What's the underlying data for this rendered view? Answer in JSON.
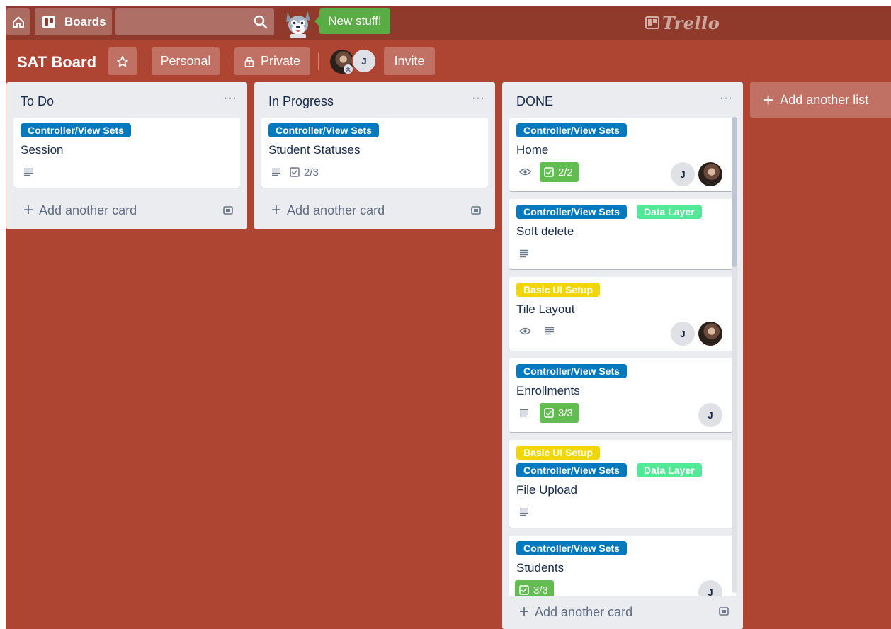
{
  "header": {
    "boards_label": "Boards",
    "search_placeholder": "",
    "new_stuff_label": "New stuff!",
    "logo_text": "Trello"
  },
  "board": {
    "title": "SAT Board",
    "visibility_team": "Personal",
    "visibility": "Private",
    "member_initial": "J",
    "invite_label": "Invite",
    "add_list_label": "Add another list"
  },
  "lists": [
    {
      "title": "To Do",
      "add_card_label": "Add another card",
      "cards": [
        {
          "labels": [
            "Controller/View Sets"
          ],
          "title": "Session"
        }
      ]
    },
    {
      "title": "In Progress",
      "add_card_label": "Add another card",
      "cards": [
        {
          "labels": [
            "Controller/View Sets"
          ],
          "title": "Student Statuses",
          "checklist": "2/3"
        }
      ]
    },
    {
      "title": "DONE",
      "add_card_label": "Add another card",
      "cards": [
        {
          "labels": [
            "Controller/View Sets"
          ],
          "title": "Home",
          "checklist": "2/2",
          "member": "J"
        },
        {
          "labels": [
            "Controller/View Sets",
            "Data Layer"
          ],
          "title": "Soft delete"
        },
        {
          "labels": [
            "Basic UI Setup"
          ],
          "title": "Tile Layout",
          "member": "J"
        },
        {
          "labels": [
            "Controller/View Sets"
          ],
          "title": "Enrollments",
          "checklist": "3/3",
          "member": "J"
        },
        {
          "labels": [
            "Basic UI Setup",
            "Controller/View Sets",
            "Data Layer"
          ],
          "title": "File Upload"
        },
        {
          "labels": [
            "Controller/View Sets"
          ],
          "title": "Students",
          "checklist": "3/3",
          "member": "J"
        }
      ]
    }
  ],
  "colors": {
    "board_bg": "#ae4532",
    "header_bg": "#8f3a2b",
    "label_blue": "#0079bf",
    "label_green": "#51e898",
    "label_yellow": "#f2d600",
    "checklist_complete": "#61bd4f",
    "new_stuff_bg": "#5aac44"
  }
}
